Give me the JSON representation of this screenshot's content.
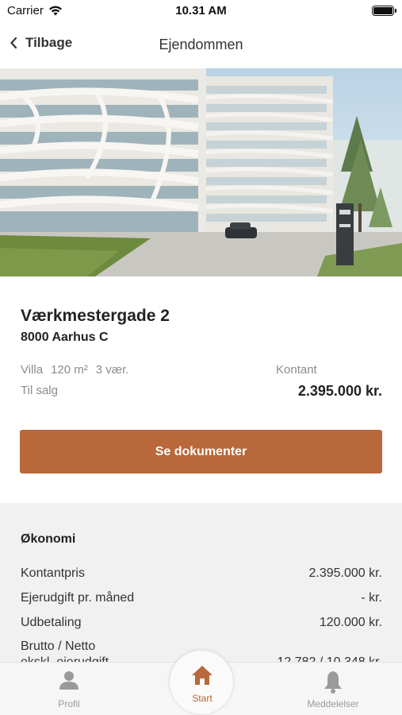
{
  "status_bar": {
    "carrier": "Carrier",
    "time": "10.31 AM",
    "wifi_icon": "wifi-icon",
    "battery_icon": "battery-icon"
  },
  "nav": {
    "back_label": "Tilbage",
    "back_icon": "chevron-left-icon",
    "title": "Ejendommen"
  },
  "hero": {
    "description_icon": "building-photo"
  },
  "property": {
    "street": "Værkmestergade 2",
    "city": "8000 Aarhus C",
    "type": "Villa",
    "area": "120 m²",
    "rooms": "3 vær.",
    "status": "Til salg",
    "price_label": "Kontant",
    "price": "2.395.000 kr."
  },
  "actions": {
    "documents_label": "Se dokumenter"
  },
  "economy": {
    "title": "Økonomi",
    "rows": [
      {
        "label": "Kontantpris",
        "value": "2.395.000 kr."
      },
      {
        "label": "Ejerudgift pr. måned",
        "value": "- kr."
      },
      {
        "label": "Udbetaling",
        "value": "120.000 kr."
      },
      {
        "label": "Brutto / Netto",
        "label2": "ekskl. ejerudgift",
        "value": "12.782 / 10.348 kr."
      }
    ]
  },
  "tabs": {
    "profil": "Profil",
    "start": "Start",
    "meddelelser": "Meddelelser"
  },
  "colors": {
    "accent": "#b8683a",
    "muted_text": "#8c8c8c",
    "section_bg": "#f1f1f1"
  }
}
